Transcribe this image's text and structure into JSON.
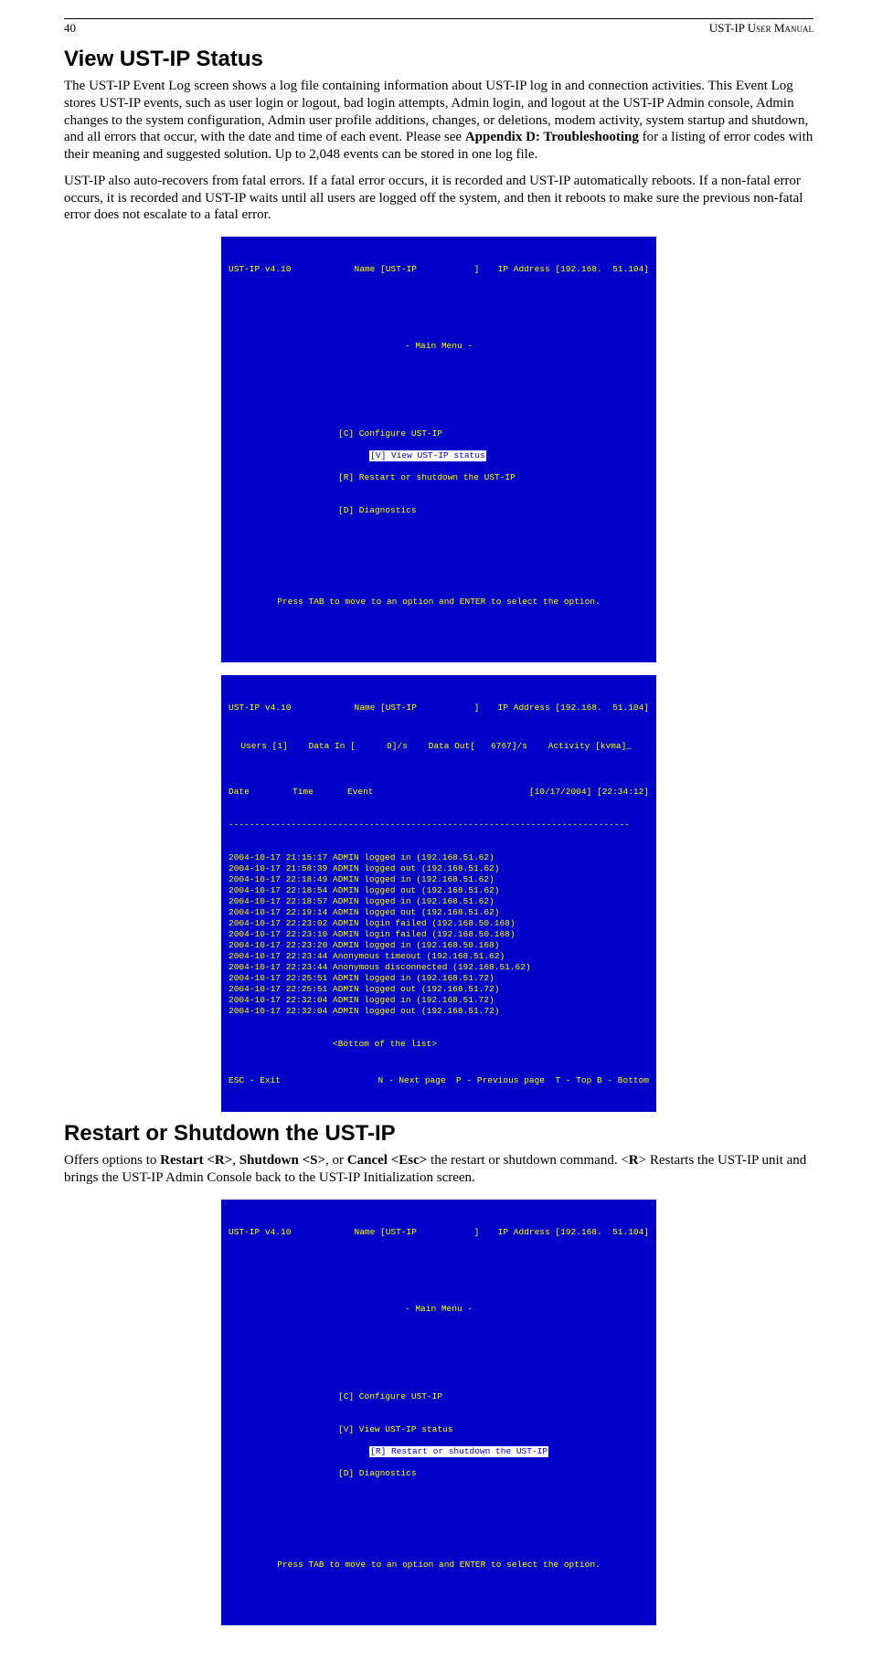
{
  "header": {
    "page_no": "40",
    "doc_title": "UST-IP User Manual"
  },
  "section1": {
    "title": "View UST-IP Status",
    "p1_a": "The UST-IP Event Log screen shows a log file containing information about UST-IP log in and connection activities. This Event Log stores UST-IP events, such as user login or logout, bad login attempts, Admin login, and logout at the UST-IP Admin console, Admin changes to the system configuration, Admin user profile additions, changes, or deletions, modem activity, system startup and shutdown, and all errors that occur, with the date and time of each event.  Please see ",
    "p1_b": "Appendix D: Troubleshooting",
    "p1_c": " for a listing of error codes with their meaning and suggested solution. Up to 2,048 events can be stored in one log file.",
    "p2": "UST-IP also auto-recovers from fatal errors. If a fatal error occurs, it is recorded and UST-IP automatically reboots. If a non-fatal error occurs, it is recorded and UST-IP waits until all users are logged off the system, and then it reboots to make sure the previous non-fatal error does not escalate to a fatal error."
  },
  "term_common": {
    "version": "UST-IP v4.10",
    "name_label": "Name [UST-IP           ]",
    "ip_label": "IP Address [192.168.  51.104]",
    "main_title": "- Main Menu -",
    "menu_c": "[C] Configure UST-IP",
    "menu_v": "[V] View UST-IP status",
    "menu_r": "[R] Restart or shutdown the UST-IP",
    "menu_d": "[D] Diagnostics",
    "tab_hint": "Press TAB to move to an option and ENTER to select the option."
  },
  "eventlog": {
    "stats": "  Users [1]    Data In [      0]/s    Data Out[   6767]/s    Activity [kvma]_",
    "col_date": "Date",
    "col_time": "Time",
    "col_event": "Event",
    "col_now": "[10/17/2004] [22:34:12]",
    "dash": "-----------------------------------------------------------------------------",
    "rows": [
      "2004-10-17 21:15:17 ADMIN logged in (192.168.51.62)",
      "2004-10-17 21:58:39 ADMIN logged out (192.168.51.62)",
      "2004-10-17 22:18:49 ADMIN logged in (192.168.51.62)",
      "2004-10-17 22:18:54 ADMIN logged out (192.168.51.62)",
      "2004-10-17 22:18:57 ADMIN logged in (192.168.51.62)",
      "2004-10-17 22:19:14 ADMIN logged out (192.168.51.62)",
      "2004-10-17 22:23:02 ADMIN login failed (192.168.50.168)",
      "2004-10-17 22:23:10 ADMIN login failed (192.168.50.168)",
      "2004-10-17 22:23:20 ADMIN logged in (192.168.50.168)",
      "2004-10-17 22:23:44 Anonymous timeout (192.168.51.62)",
      "2004-10-17 22:23:44 Anonymous disconnected (192.168.51.62)",
      "2004-10-17 22:25:51 ADMIN logged in (192.168.51.72)",
      "2004-10-17 22:25:51 ADMIN logged out (192.168.51.72)",
      "2004-10-17 22:32:04 ADMIN logged in (192.168.51.72)",
      "2004-10-17 22:32:04 ADMIN logged out (192.168.51.72)"
    ],
    "bottom_marker": "                    <Bottom of the list>",
    "esc": "ESC - Exit",
    "nav": "N - Next page  P - Previous page  T - Top B - Bottom"
  },
  "section2": {
    "title": "Restart or Shutdown the UST-IP",
    "p_a": "Offers options to ",
    "p_b": "Restart <R>",
    "p_c": ", ",
    "p_d": "Shutdown <S>",
    "p_e": ", or ",
    "p_f": "Cancel <Esc>",
    "p_g": " the restart or shutdown command.  <",
    "p_h": "R",
    "p_i": "> Restarts the UST-IP unit and brings the UST-IP Admin Console back to the UST-IP Initialization screen."
  }
}
